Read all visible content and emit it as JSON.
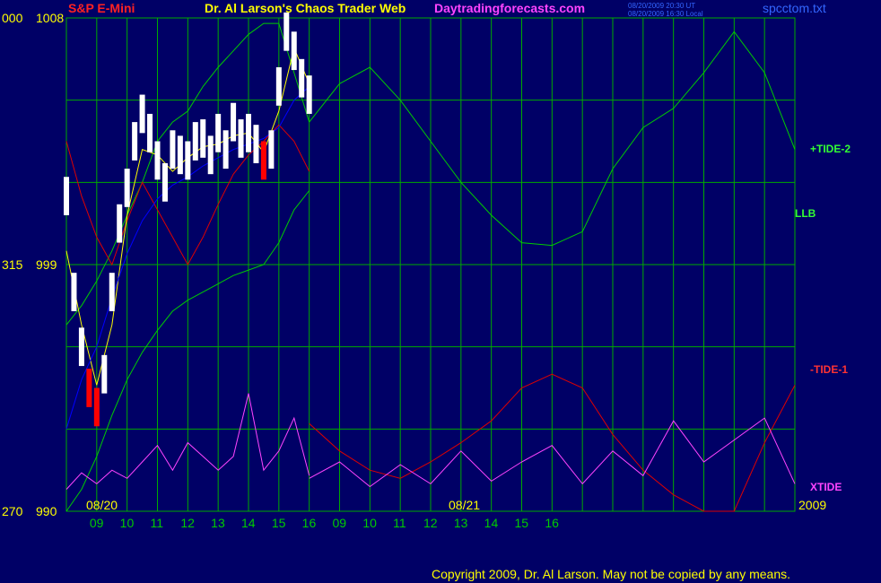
{
  "header": {
    "symbol": "S&P E-Mini",
    "title": "Dr. Al Larson's Chaos Trader Web",
    "site": "Daytradingforecasts.com",
    "timestamp_1": "08/20/2009 20:30 UT",
    "timestamp_2": "08/20/2009 16:30 Local",
    "file": "spcctom.txt"
  },
  "footer": {
    "copyright": "Copyright 2009, Dr. Al Larson. May not be copied by any means."
  },
  "colors": {
    "background": "#000066",
    "grid": "#00aa00",
    "price": "#ffffff",
    "price_down": "#ff0000",
    "avg_fast": "#ffff00",
    "avg_slow": "#0000ff",
    "tide_plus": "#00cc00",
    "tide_minus": "#dd0000",
    "xtide": "#ff44ff",
    "yellow_text": "#ffff00",
    "magenta_text": "#ff44ff",
    "blue_text": "#3366ff"
  },
  "chart_data": {
    "type": "line",
    "y_axis_left": {
      "labels": [
        {
          "angle": "000",
          "price": "1008",
          "value": 1008
        },
        {
          "angle": "315",
          "price": "999",
          "value": 999
        },
        {
          "angle": "270",
          "price": "990",
          "value": 990
        }
      ],
      "ylim": [
        990,
        1008
      ]
    },
    "x_axis": {
      "date_labels": [
        "08/20",
        "08/21",
        "2009"
      ],
      "hour_ticks": [
        "09",
        "10",
        "11",
        "12",
        "13",
        "14",
        "15",
        "16",
        "09",
        "10",
        "11",
        "12",
        "13",
        "14",
        "15",
        "16"
      ],
      "range_hours_eastern": [
        "08/20 08:00",
        "08/21 16:00"
      ]
    },
    "series": [
      {
        "name": "+TIDE-2",
        "role": "tide_plus",
        "x": [
          8.0,
          8.5,
          9.0,
          9.5,
          10.0,
          10.5,
          11.0,
          11.5,
          12.0,
          12.5,
          13.0,
          13.5,
          14.0,
          14.5,
          15.0,
          15.5,
          16.0
        ],
        "y": [
          996.8,
          997.5,
          998.4,
          999.5,
          1000.8,
          1002.0,
          1003.5,
          1004.2,
          1004.6,
          1005.5,
          1006.2,
          1006.8,
          1007.4,
          1007.8,
          1007.8,
          1006.0,
          1004.2
        ]
      },
      {
        "name": "LLB",
        "role": "llb",
        "x": [
          8.0,
          8.5,
          9.0,
          9.5,
          10.0,
          10.5,
          11.0,
          11.5,
          12.0,
          12.5,
          13.0,
          13.5,
          14.0,
          14.5,
          15.0,
          15.5,
          16.0
        ],
        "y": [
          990.0,
          990.8,
          992.0,
          993.5,
          994.8,
          995.8,
          996.6,
          997.3,
          997.7,
          998.0,
          998.3,
          998.6,
          998.8,
          999.0,
          999.8,
          1001.0,
          1001.7
        ]
      },
      {
        "name": "-TIDE-1",
        "role": "tide_minus",
        "x": [
          8.0,
          8.5,
          9.0,
          9.5,
          10.0,
          10.5,
          11.0,
          11.5,
          12.0,
          12.5,
          13.0,
          13.5,
          14.0,
          14.5,
          15.0,
          15.5,
          16.0
        ],
        "y": [
          1003.5,
          1001.5,
          1000.0,
          999.0,
          1000.6,
          1002.0,
          1001.0,
          1000.0,
          999.0,
          1000.0,
          1001.2,
          1002.3,
          1003.0,
          1003.5,
          1004.1,
          1003.5,
          1002.4
        ]
      },
      {
        "name": "XTIDE",
        "role": "xtide",
        "x": [
          8.0,
          8.5,
          9.0,
          9.5,
          10.0,
          10.5,
          11.0,
          11.5,
          12.0,
          12.5,
          13.0,
          13.5,
          14.0,
          14.5,
          15.0,
          15.5,
          16.0
        ],
        "y": [
          990.8,
          991.4,
          991.0,
          991.5,
          991.2,
          991.8,
          992.4,
          991.5,
          992.5,
          992.0,
          991.5,
          992.0,
          994.3,
          991.5,
          992.2,
          993.4,
          991.3
        ]
      }
    ],
    "forecast_series": [
      {
        "name": "+TIDE-2",
        "role": "tide_plus",
        "x": [
          16.0,
          17.0,
          18.0,
          19.0,
          20.0,
          21.0,
          22.0,
          23.0,
          24.0,
          25.0,
          26.0,
          27.0,
          28.0,
          29.0,
          30.0,
          31.0,
          32.0
        ],
        "y": [
          1004.2,
          1005.6,
          1006.2,
          1005.0,
          1003.5,
          1002.0,
          1000.8,
          999.8,
          999.7,
          1000.2,
          1002.5,
          1004.0,
          1004.7,
          1006.0,
          1007.5,
          1006.0,
          1003.2
        ]
      },
      {
        "name": "-TIDE-1",
        "role": "tide_minus",
        "x": [
          16.0,
          17.0,
          18.0,
          19.0,
          20.0,
          21.0,
          22.0,
          23.0,
          24.0,
          25.0,
          26.0,
          27.0,
          28.0,
          29.0,
          30.0,
          31.0,
          32.0
        ],
        "y": [
          993.2,
          992.2,
          991.5,
          991.2,
          991.8,
          992.5,
          993.3,
          994.5,
          995.0,
          994.5,
          992.8,
          991.5,
          990.6,
          990.0,
          990.0,
          992.5,
          994.6
        ]
      },
      {
        "name": "XTIDE",
        "role": "xtide",
        "x": [
          16.0,
          17.0,
          18.0,
          19.0,
          20.0,
          21.0,
          22.0,
          23.0,
          24.0,
          25.0,
          26.0,
          27.0,
          28.0,
          29.0,
          30.0,
          31.0,
          32.0
        ],
        "y": [
          991.2,
          991.8,
          990.9,
          991.7,
          991.0,
          992.2,
          991.1,
          991.8,
          992.4,
          991.0,
          992.2,
          991.3,
          993.3,
          991.8,
          992.6,
          993.4,
          991.0
        ]
      }
    ],
    "price_bars": {
      "x": [
        8.0,
        8.25,
        8.5,
        8.75,
        9.0,
        9.25,
        9.5,
        9.75,
        10.0,
        10.25,
        10.5,
        10.75,
        11.0,
        11.25,
        11.5,
        11.75,
        12.0,
        12.25,
        12.5,
        12.75,
        13.0,
        13.25,
        13.5,
        13.75,
        14.0,
        14.25,
        14.5,
        14.75,
        15.0,
        15.25,
        15.5,
        15.75,
        16.0
      ],
      "y": [
        1001.5,
        998.0,
        996.0,
        994.5,
        993.8,
        995.0,
        998.0,
        1000.5,
        1001.8,
        1003.5,
        1004.5,
        1003.8,
        1002.8,
        1002.0,
        1003.2,
        1003.0,
        1002.8,
        1003.5,
        1003.6,
        1003.0,
        1003.8,
        1003.2,
        1004.2,
        1003.6,
        1003.8,
        1003.4,
        1002.8,
        1003.2,
        1005.5,
        1007.5,
        1006.8,
        1005.8,
        1005.2
      ],
      "down_ranges": [
        [
          8.6,
          9.2
        ],
        [
          14.3,
          14.7
        ]
      ]
    },
    "moving_averages": [
      {
        "name": "fast",
        "role": "avg_fast",
        "x": [
          8.0,
          8.5,
          9.0,
          9.5,
          10.0,
          10.5,
          11.0,
          11.5,
          12.0,
          12.5,
          13.0,
          13.5,
          14.0,
          14.5,
          15.0,
          15.5,
          16.0
        ],
        "y": [
          999.5,
          996.8,
          994.6,
          996.8,
          1000.8,
          1003.2,
          1003.0,
          1002.4,
          1002.9,
          1003.3,
          1003.4,
          1003.7,
          1003.8,
          1003.1,
          1004.6,
          1006.9,
          1005.6
        ]
      },
      {
        "name": "slow",
        "role": "avg_slow",
        "x": [
          8.0,
          8.5,
          9.0,
          9.5,
          10.0,
          10.5,
          11.0,
          11.5,
          12.0,
          12.5,
          13.0,
          13.5,
          14.0,
          14.5,
          15.0,
          15.5,
          16.0
        ],
        "y": [
          993.0,
          994.8,
          996.0,
          997.8,
          999.4,
          1000.6,
          1001.4,
          1001.9,
          1002.2,
          1002.6,
          1002.9,
          1003.2,
          1003.4,
          1003.6,
          1004.0,
          1005.0,
          1005.5
        ]
      }
    ],
    "series_labels": [
      {
        "text": "+TIDE-2",
        "role": "tide_plus"
      },
      {
        "text": "LLB",
        "role": "llb"
      },
      {
        "text": "-TIDE-1",
        "role": "tide_minus"
      },
      {
        "text": "XTIDE",
        "role": "xtide"
      }
    ],
    "grid": true
  }
}
